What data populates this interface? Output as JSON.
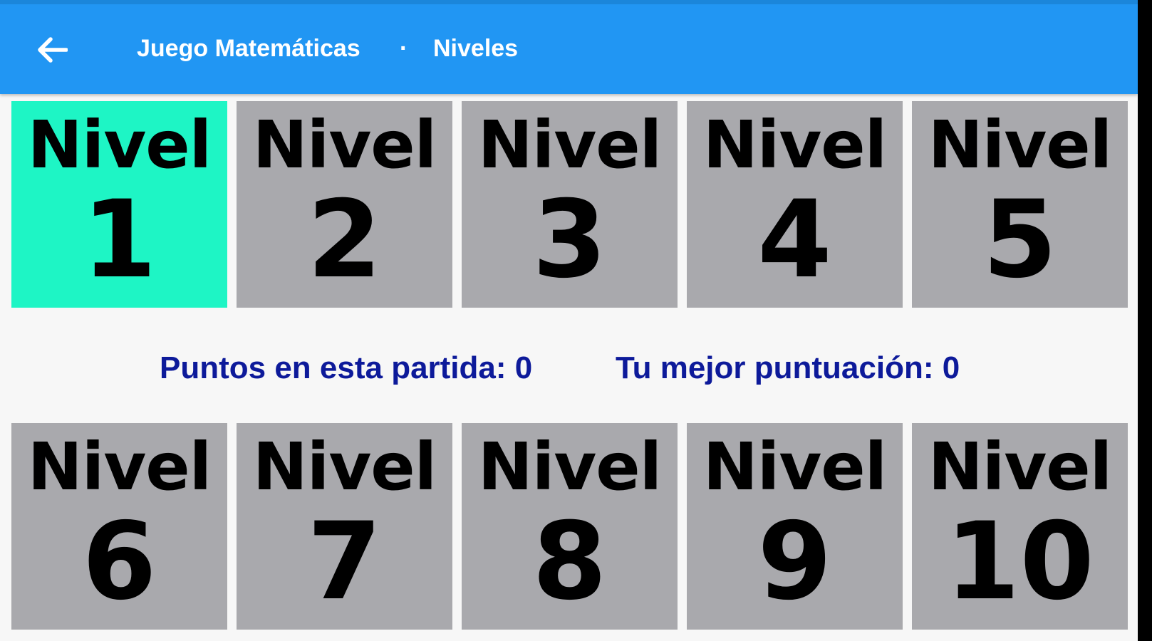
{
  "app_bar": {
    "app_title": "Juego Matemáticas",
    "separator": "·",
    "page_title": "Niveles",
    "back_icon": "arrow-back-icon"
  },
  "levels": [
    {
      "label": "Nivel",
      "number": "1",
      "active": true
    },
    {
      "label": "Nivel",
      "number": "2",
      "active": false
    },
    {
      "label": "Nivel",
      "number": "3",
      "active": false
    },
    {
      "label": "Nivel",
      "number": "4",
      "active": false
    },
    {
      "label": "Nivel",
      "number": "5",
      "active": false
    },
    {
      "label": "Nivel",
      "number": "6",
      "active": false
    },
    {
      "label": "Nivel",
      "number": "7",
      "active": false
    },
    {
      "label": "Nivel",
      "number": "8",
      "active": false
    },
    {
      "label": "Nivel",
      "number": "9",
      "active": false
    },
    {
      "label": "Nivel",
      "number": "10",
      "active": false
    }
  ],
  "scores": {
    "current": "Puntos en esta partida: 0",
    "best": "Tu mejor puntuación: 0"
  },
  "colors": {
    "app_bar": "#2196f3",
    "active_tile": "#1ef5c5",
    "tile": "#a9a9ad",
    "score_text": "#0d1a9a",
    "background": "#f7f7f7"
  }
}
